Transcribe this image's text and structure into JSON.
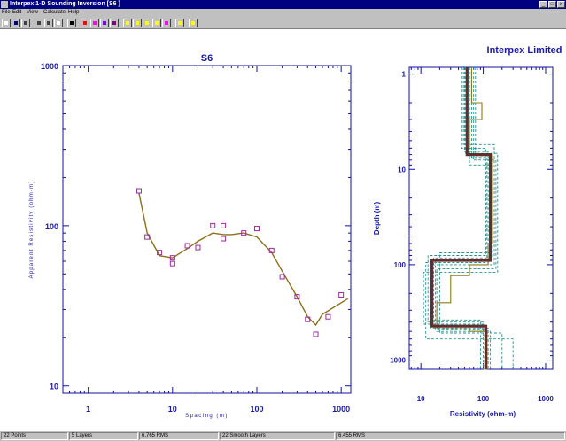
{
  "window": {
    "title": "Interpex 1-D Sounding Inversion [S6                          ]"
  },
  "menu": {
    "items": [
      "File",
      "Edit",
      "View",
      "Calculate",
      "Help"
    ]
  },
  "toolbar": {
    "buttons": [
      {
        "name": "new-icon",
        "color": "#ffffff"
      },
      {
        "name": "save-icon",
        "color": "#000080"
      },
      {
        "name": "print-icon",
        "color": "#404040"
      },
      {
        "name": "columns-icon",
        "color": "#404040"
      },
      {
        "name": "table-icon",
        "color": "#404040"
      },
      {
        "name": "grid-icon",
        "color": "#ffffff"
      },
      {
        "name": "pointer-icon",
        "color": "#000000"
      },
      {
        "name": "edit-model-icon",
        "color": "#ff0000"
      },
      {
        "name": "layers-icon",
        "color": "#ff00ff"
      },
      {
        "name": "calc-icon",
        "color": "#8000ff"
      },
      {
        "name": "sum-icon",
        "color": "#800080"
      },
      {
        "name": "forward-icon",
        "color": "#ffff00"
      },
      {
        "name": "back-icon",
        "color": "#ffff00"
      },
      {
        "name": "smooth-icon",
        "color": "#ffff00"
      },
      {
        "name": "equivalence-icon",
        "color": "#ffff00"
      },
      {
        "name": "fit-icon",
        "color": "#ff00ff"
      },
      {
        "name": "stop-icon",
        "color": "#ffff00"
      },
      {
        "name": "help-icon",
        "color": "#ffff00"
      }
    ]
  },
  "header": {
    "company": "Interpex Limited"
  },
  "status": {
    "points": "22 Points",
    "layers": "5 Layers",
    "rms": "6.765 RMS",
    "smooth_layers": "22 Smooth Layers",
    "smooth_rms": "6.455 RMS"
  },
  "chart_data": [
    {
      "type": "scatter",
      "title": "S6",
      "xlabel": "Spacing (m)",
      "ylabel": "Apparent Resistivity (ohm-m)",
      "x_scale": "log",
      "y_scale": "log",
      "xlim": [
        0.5,
        1300
      ],
      "ylim": [
        9,
        1000
      ],
      "xticks": [
        "1",
        "10",
        "100",
        "1000"
      ],
      "yticks": [
        "1000",
        "100",
        "10"
      ],
      "x_tick_values": [
        1,
        10,
        100,
        1000
      ],
      "y_tick_values": [
        1000,
        100,
        10
      ],
      "series": [
        {
          "kind": "points",
          "color": "#9a2a9a",
          "x": [
            4,
            5,
            7,
            10,
            10,
            15,
            20,
            30,
            40,
            40,
            70,
            100,
            150,
            200,
            300,
            400,
            500,
            700,
            1000
          ],
          "y": [
            165,
            85,
            68,
            63,
            58,
            75,
            73,
            100,
            100,
            83,
            90,
            96,
            70,
            48,
            36,
            26,
            21,
            27,
            37
          ]
        },
        {
          "kind": "line",
          "color": "#8b6f1a",
          "x": [
            4,
            5,
            7,
            10,
            15,
            20,
            30,
            40,
            50,
            70,
            100,
            150,
            200,
            300,
            400,
            500,
            600,
            1200
          ],
          "y": [
            160,
            90,
            65,
            63,
            72,
            80,
            90,
            88,
            88,
            90,
            85,
            68,
            52,
            36,
            27,
            24,
            28,
            35
          ]
        }
      ]
    },
    {
      "type": "line",
      "xlabel": "Resistivity (ohm-m)",
      "ylabel": "Depth (m)",
      "x_scale": "log",
      "y_scale": "log",
      "y_inverted": true,
      "xlim": [
        6.5,
        1300
      ],
      "ylim": [
        0.85,
        1250
      ],
      "xticks": [
        "10",
        "100",
        "1000"
      ],
      "yticks": [
        "1",
        "10",
        "100",
        "1000"
      ],
      "x_tick_values": [
        10,
        100,
        1000
      ],
      "y_tick_values": [
        1,
        10,
        100,
        1000
      ],
      "series": [
        {
          "kind": "step",
          "role": "model",
          "color": "#8b1a1a",
          "res": [
            55,
            130,
            15,
            110
          ],
          "depth": [
            0.85,
            7,
            90,
            440,
            1250
          ]
        },
        {
          "kind": "smooth",
          "color": "#8b7a1a",
          "res": [
            65,
            95,
            60,
            55,
            140,
            140,
            120,
            60,
            30,
            18,
            18,
            60,
            115,
            100
          ],
          "depth": [
            0.85,
            2,
            3,
            6,
            7,
            30,
            60,
            100,
            130,
            250,
            420,
            470,
            500,
            1250
          ]
        },
        {
          "kind": "equivalent",
          "color": "#2a8f8f",
          "models": [
            {
              "res": [
                45,
                110,
                13,
                100
              ],
              "depth": [
                0.85,
                6,
                80,
                400,
                1250
              ]
            },
            {
              "res": [
                70,
                160,
                18,
                130
              ],
              "depth": [
                0.85,
                8,
                110,
                500,
                1250
              ]
            },
            {
              "res": [
                50,
                120,
                12,
                300
              ],
              "depth": [
                0.85,
                6.5,
                95,
                600,
                1250
              ]
            },
            {
              "res": [
                65,
                140,
                16,
                90
              ],
              "depth": [
                0.85,
                7.5,
                85,
                380,
                1250
              ]
            },
            {
              "res": [
                48,
                150,
                14,
                120
              ],
              "depth": [
                0.85,
                5.5,
                100,
                460,
                1250
              ]
            },
            {
              "res": [
                60,
                125,
                20,
                200
              ],
              "depth": [
                0.85,
                9,
                75,
                520,
                1250
              ]
            },
            {
              "res": [
                52,
                170,
                11,
                105
              ],
              "depth": [
                0.85,
                6.8,
                120,
                420,
                1250
              ]
            },
            {
              "res": [
                75,
                115,
                17,
                115
              ],
              "depth": [
                0.85,
                7.2,
                88,
                480,
                1250
              ]
            }
          ]
        }
      ]
    }
  ]
}
